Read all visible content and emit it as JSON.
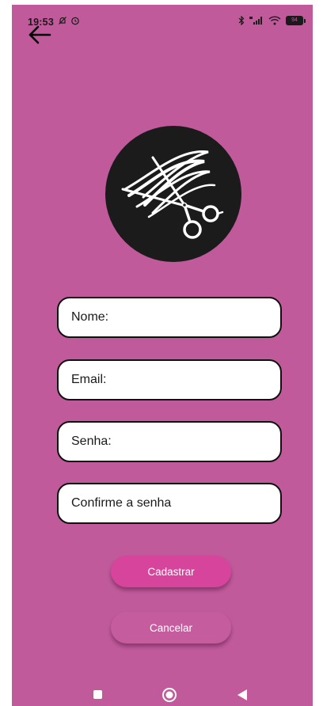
{
  "status_bar": {
    "time": "19:53",
    "battery": "94"
  },
  "form": {
    "name_placeholder": "Nome:",
    "email_placeholder": "Email:",
    "password_placeholder": "Senha:",
    "confirm_placeholder": "Confirme a senha"
  },
  "actions": {
    "register_label": "Cadastrar",
    "cancel_label": "Cancelar"
  },
  "colors": {
    "background": "#c05a9b",
    "primary_button": "#d6449c",
    "logo_circle": "#1b1b1b"
  },
  "icons": {
    "back": "arrow-left-icon",
    "logo": "scissors-hair-logo",
    "nav_recents": "square-icon",
    "nav_home": "circle-icon",
    "nav_back": "triangle-back-icon"
  }
}
